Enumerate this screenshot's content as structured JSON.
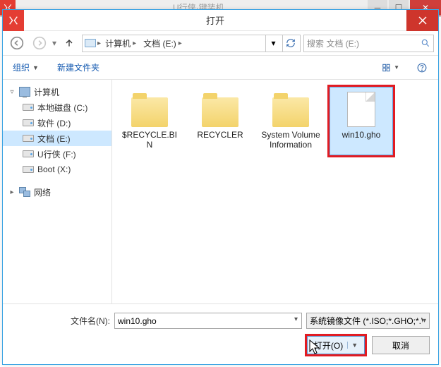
{
  "backdrop": {
    "title": "U行侠·键装机"
  },
  "dialog": {
    "title": "打开",
    "breadcrumb": {
      "segments": [
        "计算机",
        "文档 (E:)"
      ]
    },
    "search_placeholder": "搜索 文档 (E:)",
    "toolbar": {
      "organize": "组织",
      "new_folder": "新建文件夹"
    },
    "sidebar": {
      "root": "计算机",
      "drives": [
        {
          "label": "本地磁盘 (C:)"
        },
        {
          "label": "软件 (D:)"
        },
        {
          "label": "文档 (E:)",
          "selected": true
        },
        {
          "label": "U行侠 (F:)"
        },
        {
          "label": "Boot (X:)"
        }
      ],
      "network": "网络"
    },
    "files": [
      {
        "kind": "folder",
        "name": "$RECYCLE.BIN"
      },
      {
        "kind": "folder",
        "name": "RECYCLER"
      },
      {
        "kind": "folder",
        "name": "System Volume Information"
      },
      {
        "kind": "file",
        "name": "win10.gho",
        "selected": true
      }
    ],
    "footer": {
      "filename_label": "文件名(N):",
      "filename_value": "win10.gho",
      "filter_label": "系统镜像文件 (*.ISO;*.GHO;*.WIM)",
      "open": "打开(O)",
      "cancel": "取消"
    }
  }
}
